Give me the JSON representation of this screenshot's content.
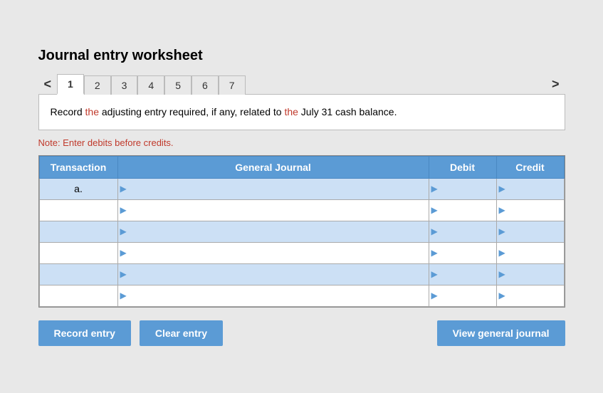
{
  "title": "Journal entry worksheet",
  "tabs": [
    {
      "label": "1",
      "active": true
    },
    {
      "label": "2",
      "active": false
    },
    {
      "label": "3",
      "active": false
    },
    {
      "label": "4",
      "active": false
    },
    {
      "label": "5",
      "active": false
    },
    {
      "label": "6",
      "active": false
    },
    {
      "label": "7",
      "active": false
    }
  ],
  "nav": {
    "prev": "<",
    "next": ">"
  },
  "instruction": "Record the adjusting entry required, if any, related to the July 31 cash balance.",
  "note": "Note: Enter debits before credits.",
  "table": {
    "headers": [
      "Transaction",
      "General Journal",
      "Debit",
      "Credit"
    ],
    "rows": [
      {
        "transaction": "a.",
        "journal": "",
        "debit": "",
        "credit": ""
      },
      {
        "transaction": "",
        "journal": "",
        "debit": "",
        "credit": ""
      },
      {
        "transaction": "",
        "journal": "",
        "debit": "",
        "credit": ""
      },
      {
        "transaction": "",
        "journal": "",
        "debit": "",
        "credit": ""
      },
      {
        "transaction": "",
        "journal": "",
        "debit": "",
        "credit": ""
      },
      {
        "transaction": "",
        "journal": "",
        "debit": "",
        "credit": ""
      }
    ]
  },
  "buttons": {
    "record": "Record entry",
    "clear": "Clear entry",
    "view": "View general journal"
  }
}
